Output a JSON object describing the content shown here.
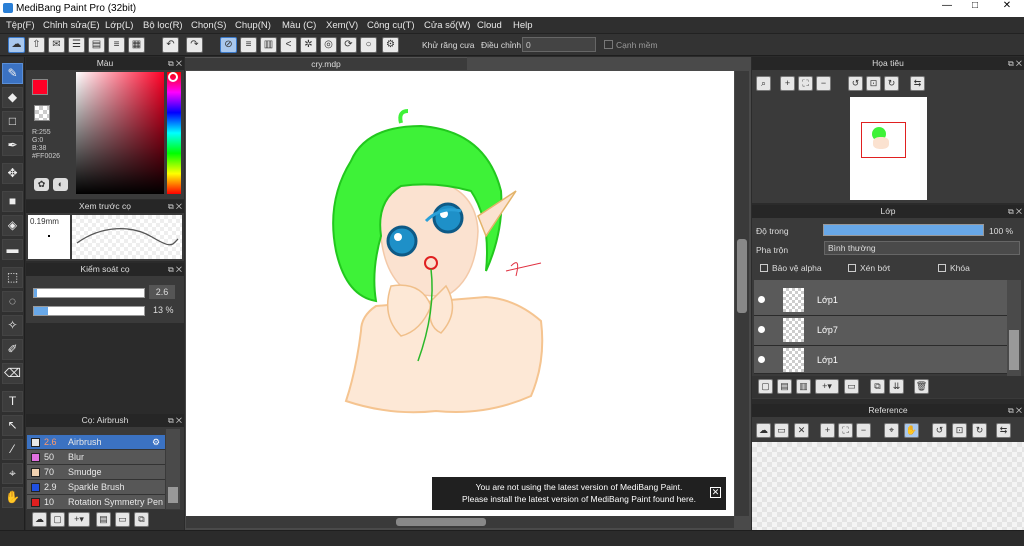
{
  "window": {
    "title": "MediBang Paint Pro (32bit)",
    "minimize": "—",
    "maximize": "□",
    "close": "✕"
  },
  "menu": [
    "Tệp(F)",
    "Chỉnh sửa(E)",
    "Lớp(L)",
    "Bộ lọc(R)",
    "Chọn(S)",
    "Chụp(N)",
    "Màu (C)",
    "Xem(V)",
    "Công cụ(T)",
    "Cửa số(W)",
    "Cloud",
    "Help"
  ],
  "toolbar": {
    "antialias_label": "Khử răng cưa",
    "adjust_label": "Điều chỉnh",
    "adjust_value": "0",
    "edge_label": "Cạnh mềm"
  },
  "color_panel": {
    "title": "Màu",
    "r": "R:255",
    "g": "G:0",
    "b": "B:38",
    "hex": "#FF0026",
    "primary_color": "#ff0026"
  },
  "preview_panel": {
    "title": "Xem trước cọ",
    "size": "0.19mm"
  },
  "control_panel": {
    "title": "Kiểm soát cọ",
    "size_value": "2.6",
    "opacity_value": "13 %",
    "size_fraction": 0.03,
    "opacity_fraction": 0.13
  },
  "brush_panel": {
    "title": "Cọ: Airbrush",
    "items": [
      {
        "size": "2.6",
        "name": "Airbrush",
        "color": "#e8e8e8",
        "selected": true
      },
      {
        "size": "50",
        "name": "Blur",
        "color": "#e070e0",
        "selected": false
      },
      {
        "size": "70",
        "name": "Smudge",
        "color": "#f2d2b0",
        "selected": false
      },
      {
        "size": "2.9",
        "name": "Sparkle Brush",
        "color": "#2050e0",
        "selected": false
      },
      {
        "size": "10",
        "name": "Rotation Symmetry Pen",
        "color": "#e02020",
        "selected": false
      }
    ]
  },
  "canvas": {
    "tab": "cry.mdp"
  },
  "notice": {
    "line1": "You are not using the latest version of MediBang Paint.",
    "line2": "Please install the latest version of MediBang Paint found here."
  },
  "navigator": {
    "title": "Họa tiêu"
  },
  "layers": {
    "title": "Lớp",
    "opacity_label": "Độ trong",
    "opacity_value": "100 %",
    "opacity_fraction": 1.0,
    "blend_label": "Pha trộn",
    "blend_value": "Bình thường",
    "protect_alpha": "Bảo vệ alpha",
    "clipping": "Xén bớt",
    "lock": "Khóa",
    "items": [
      "Lớp1",
      "Lớp7",
      "Lớp1"
    ]
  },
  "reference": {
    "title": "Reference"
  }
}
